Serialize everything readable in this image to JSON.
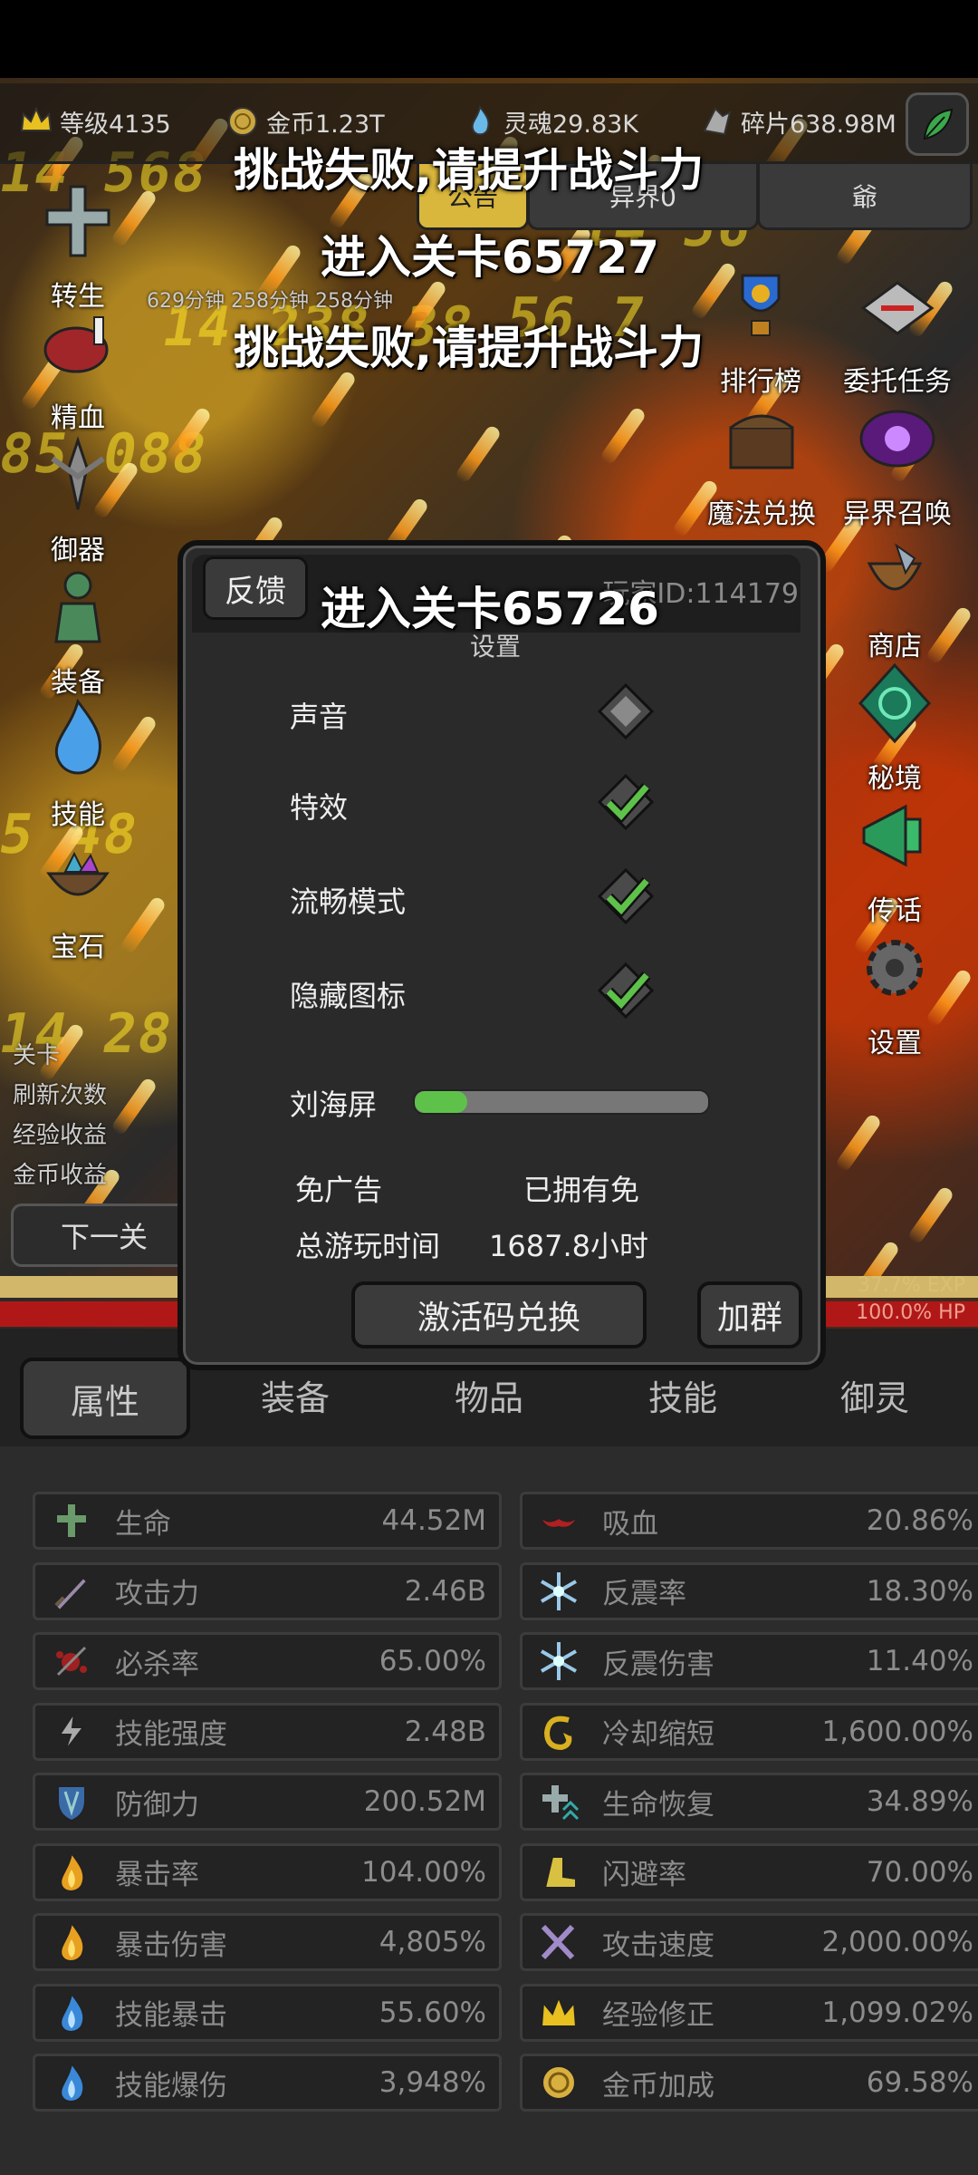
{
  "resources": {
    "level": "等级4135",
    "gold": "金币1.23T",
    "soul": "灵魂29.83K",
    "shards": "碎片638.98M"
  },
  "top_tabs": {
    "notice": "公告",
    "otherworld": "异界0",
    "third": "爺"
  },
  "timers": "629分钟  258分钟  258分钟",
  "left_menu": [
    {
      "label": "转生"
    },
    {
      "label": "精血"
    },
    {
      "label": "御器"
    },
    {
      "label": "装备"
    },
    {
      "label": "技能"
    },
    {
      "label": "宝石"
    }
  ],
  "right_menu": [
    {
      "label": "排行榜"
    },
    {
      "label": "委托任务"
    },
    {
      "label": "魔法兑换"
    },
    {
      "label": "异界召唤"
    },
    {
      "label": "商店"
    },
    {
      "label": "秘境"
    },
    {
      "label": "传话"
    },
    {
      "label": "设置"
    }
  ],
  "messages": {
    "fail1": "挑战失败,请提升战斗力",
    "enter1": "进入关卡65727",
    "fail2": "挑战失败,请提升战斗力",
    "enter2": "进入关卡65726"
  },
  "left_info": {
    "line1": "关卡",
    "line2": "刷新次数",
    "line3": "经验收益",
    "line4": "金币收益"
  },
  "next_stage": "下一关",
  "exp_label": "37.7% EXP",
  "hp_label": "100.0%  HP",
  "dialog": {
    "feedback": "反馈",
    "uid": "玩家ID:114179",
    "title": "设置",
    "sound": "声音",
    "sound_on": false,
    "effects": "特效",
    "effects_on": true,
    "smooth": "流畅模式",
    "smooth_on": true,
    "hide_icons": "隐藏图标",
    "hide_icons_on": true,
    "notch": "刘海屏",
    "notch_level": 0.18,
    "no_ads": "免广告",
    "no_ads_value": "已拥有免",
    "playtime": "总游玩时间",
    "playtime_value": "1687.8小时",
    "redeem": "激活码兑换",
    "join_group": "加群"
  },
  "bottom_tabs": [
    "属性",
    "装备",
    "物品",
    "技能",
    "御灵"
  ],
  "stats_left": [
    {
      "name": "生命",
      "value": "44.52M",
      "icon": "health-cross-icon"
    },
    {
      "name": "攻击力",
      "value": "2.46B",
      "icon": "sword-icon"
    },
    {
      "name": "必杀率",
      "value": "65.00%",
      "icon": "blood-splash-icon"
    },
    {
      "name": "技能强度",
      "value": "2.48B",
      "icon": "lightning-icon"
    },
    {
      "name": "防御力",
      "value": "200.52M",
      "icon": "shield-icon"
    },
    {
      "name": "暴击率",
      "value": "104.00%",
      "icon": "flame-icon"
    },
    {
      "name": "暴击伤害",
      "value": "4,805%",
      "icon": "flame-icon"
    },
    {
      "name": "技能暴击",
      "value": "55.60%",
      "icon": "blue-flame-icon"
    },
    {
      "name": "技能爆伤",
      "value": "3,948%",
      "icon": "blue-flame-icon"
    }
  ],
  "stats_right": [
    {
      "name": "吸血",
      "value": "20.86%",
      "icon": "bat-icon"
    },
    {
      "name": "反震率",
      "value": "18.30%",
      "icon": "ice-burst-icon"
    },
    {
      "name": "反震伤害",
      "value": "11.40%",
      "icon": "ice-burst-icon"
    },
    {
      "name": "冷却缩短",
      "value": "1,600.00%",
      "icon": "swirl-icon"
    },
    {
      "name": "生命恢复",
      "value": "34.89%",
      "icon": "regen-cross-icon"
    },
    {
      "name": "闪避率",
      "value": "70.00%",
      "icon": "boot-icon"
    },
    {
      "name": "攻击速度",
      "value": "2,000.00%",
      "icon": "crossed-swords-icon"
    },
    {
      "name": "经验修正",
      "value": "1,099.02%",
      "icon": "crown-icon"
    },
    {
      "name": "金币加成",
      "value": "69.58%",
      "icon": "gold-coin-icon"
    }
  ],
  "colors": {
    "hp": "#b01818",
    "exp": "#d2b76a",
    "check": "#5ec24a"
  }
}
